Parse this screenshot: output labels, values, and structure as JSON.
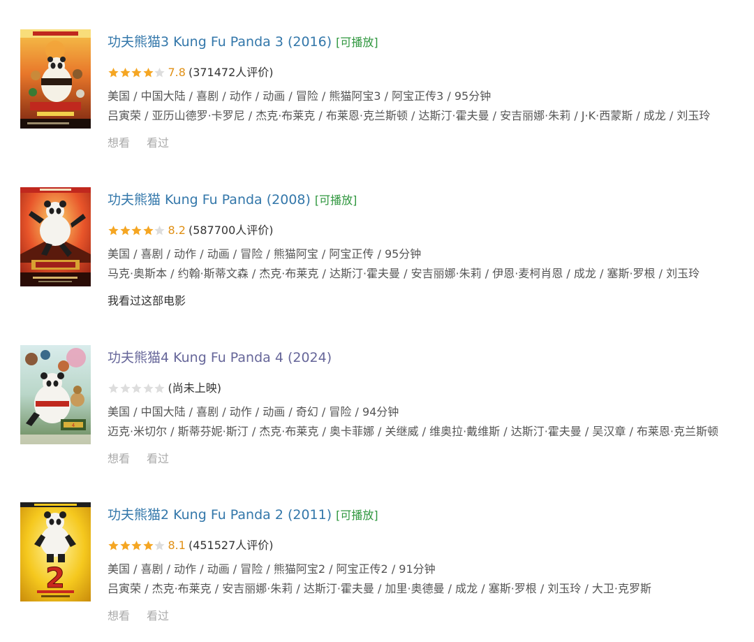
{
  "items": [
    {
      "poster_icon": "kung-fu-panda-3-poster",
      "title": "功夫熊猫3 Kung Fu Panda 3 (2016)",
      "playable": "[可播放]",
      "stars_filled": 4,
      "score": "7.8",
      "votes": "(371472人评价)",
      "meta": "美国 / 中国大陆 / 喜剧 / 动作 / 动画 / 冒险 / 熊猫阿宝3 / 阿宝正传3 / 95分钟",
      "cast": "吕寅荣 / 亚历山德罗·卡罗尼 / 杰克·布莱克 / 布莱恩·克兰斯顿 / 达斯汀·霍夫曼 / 安吉丽娜·朱莉 / J·K·西蒙斯 / 成龙 / 刘玉玲",
      "want": "想看",
      "seen": "看过"
    },
    {
      "poster_icon": "kung-fu-panda-poster",
      "title": "功夫熊猫 Kung Fu Panda (2008)",
      "playable": "[可播放]",
      "stars_filled": 4,
      "score": "8.2",
      "votes": "(587700人评价)",
      "meta": "美国 / 喜剧 / 动作 / 动画 / 冒险 / 熊猫阿宝 / 阿宝正传 / 95分钟",
      "cast": "马克·奥斯本 / 约翰·斯蒂文森 / 杰克·布莱克 / 达斯汀·霍夫曼 / 安吉丽娜·朱莉 / 伊恩·麦柯肖恩 / 成龙 / 塞斯·罗根 / 刘玉玲",
      "seen_status": "我看过这部电影"
    },
    {
      "poster_icon": "kung-fu-panda-4-poster",
      "title": "功夫熊猫4 Kung Fu Panda 4 (2024)",
      "stars_filled": 0,
      "votes": "(尚未上映)",
      "meta": "美国 / 中国大陆 / 喜剧 / 动作 / 动画 / 奇幻 / 冒险 / 94分钟",
      "cast": "迈克·米切尔 / 斯蒂芬妮·斯汀 / 杰克·布莱克 / 奥卡菲娜 / 关继威 / 维奥拉·戴维斯 / 达斯汀·霍夫曼 / 吴汉章 / 布莱恩·克兰斯顿",
      "want": "想看",
      "seen": "看过"
    },
    {
      "poster_icon": "kung-fu-panda-2-poster",
      "title": "功夫熊猫2 Kung Fu Panda 2 (2011)",
      "playable": "[可播放]",
      "stars_filled": 4,
      "score": "8.1",
      "votes": "(451527人评价)",
      "meta": "美国 / 喜剧 / 动作 / 动画 / 冒险 / 熊猫阿宝2 / 阿宝正传2 / 91分钟",
      "cast": "吕寅荣 / 杰克·布莱克 / 安吉丽娜·朱莉 / 达斯汀·霍夫曼 / 加里·奥德曼 / 成龙 / 塞斯·罗根 / 刘玉玲 / 大卫·克罗斯",
      "want": "想看",
      "seen": "看过"
    }
  ],
  "colors": {
    "title": "#3377aa",
    "title_visited": "#666699",
    "playable": "#2e963d",
    "star_filled": "#f5a623",
    "star_empty": "#dddddd",
    "score": "#e09015",
    "muted": "#aaaaaa"
  }
}
